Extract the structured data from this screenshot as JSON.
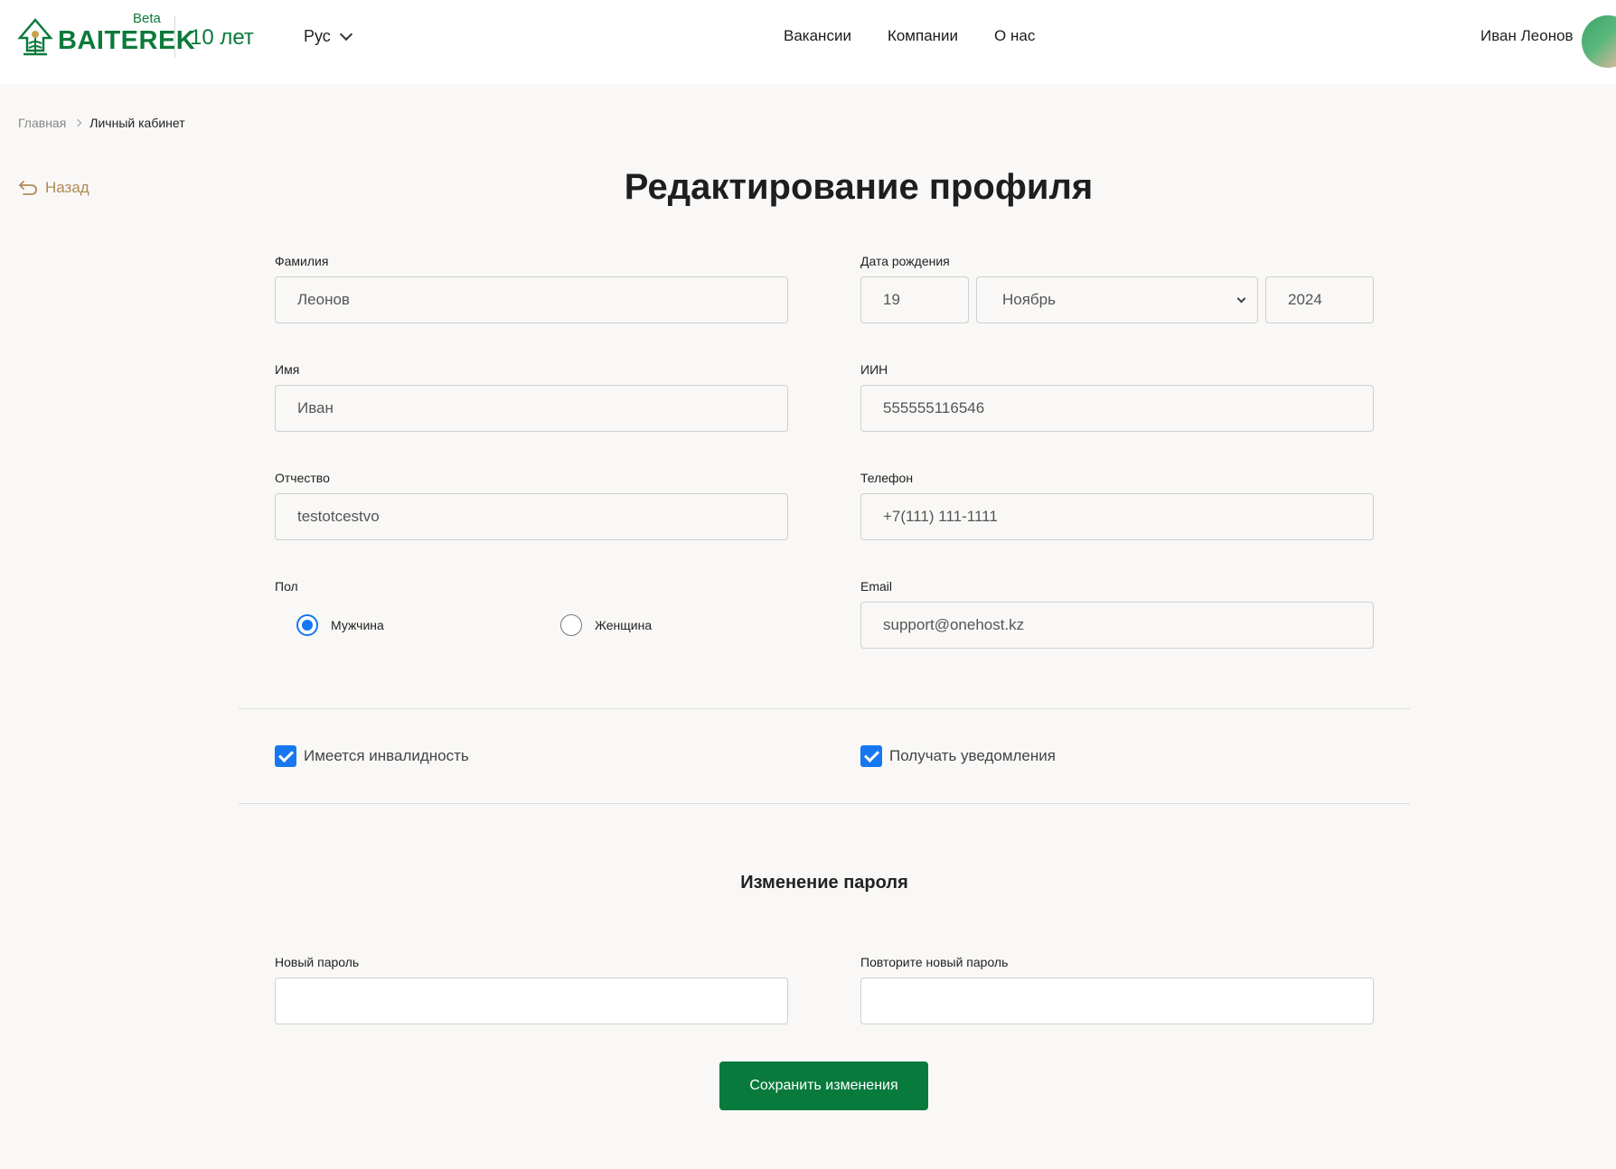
{
  "header": {
    "logo_text": "BAITEREK",
    "logo_badge": "Beta",
    "logo_years": "10 лет",
    "language": "Рус",
    "nav": [
      "Вакансии",
      "Компании",
      "О нас"
    ],
    "user_name": "Иван Леонов",
    "brand_color": "#0b7a3b"
  },
  "breadcrumb": {
    "home": "Главная",
    "current": "Личный кабинет"
  },
  "back_label": "Назад",
  "title": "Редактирование профиля",
  "form": {
    "last_name": {
      "label": "Фамилия",
      "value": "Леонов"
    },
    "first_name": {
      "label": "Имя",
      "value": "Иван"
    },
    "patronymic": {
      "label": "Отчество",
      "value": "testotcestvo"
    },
    "gender": {
      "label": "Пол",
      "male": "Мужчина",
      "female": "Женщина",
      "selected": "male"
    },
    "birth": {
      "label": "Дата рождения",
      "day": "19",
      "month": "Ноябрь",
      "year": "2024"
    },
    "iin": {
      "label": "ИИН",
      "value": "555555116546"
    },
    "phone": {
      "label": "Телефон",
      "value": "+7(111) 111-1111"
    },
    "email": {
      "label": "Email",
      "value": "support@onehost.kz"
    },
    "disability": {
      "label": "Имеется инвалидность",
      "checked": true
    },
    "notifications": {
      "label": "Получать уведомления",
      "checked": true
    }
  },
  "password": {
    "title": "Изменение пароля",
    "new_label": "Новый пароль",
    "repeat_label": "Повторите новый пароль"
  },
  "save_label": "Сохранить изменения",
  "accent_color": "#1677f0",
  "button_color": "#087a3c"
}
